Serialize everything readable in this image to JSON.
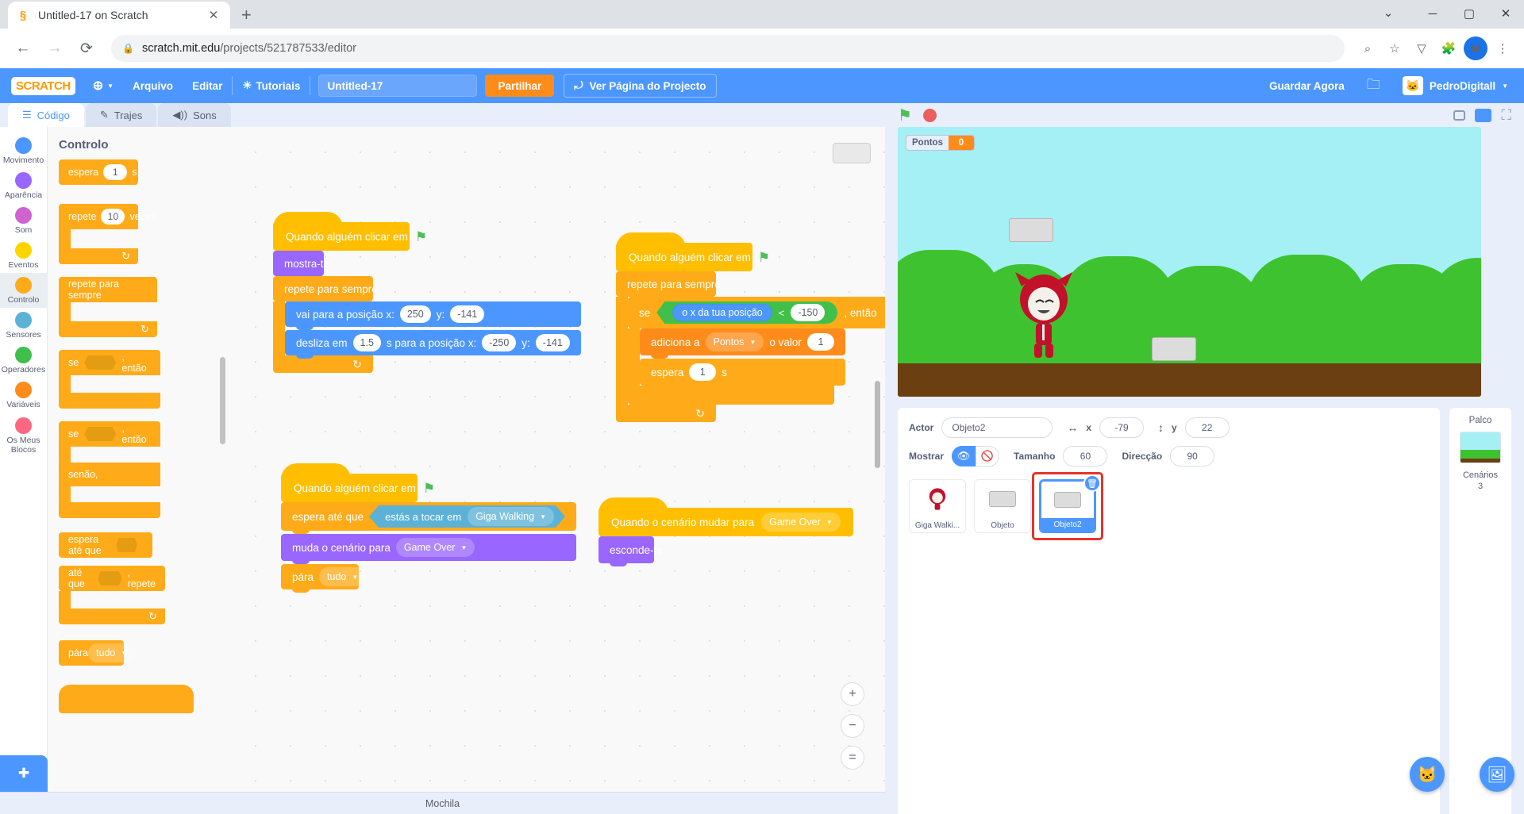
{
  "browser": {
    "tab_title": "Untitled-17 on Scratch",
    "tab_favicon": "scratch-icon",
    "new_tab": "+",
    "close": "✕",
    "url_host": "scratch.mit.edu",
    "url_path": "/projects/521787533/editor",
    "avatar_letter": "M",
    "minimize": "─",
    "maximize": "▢",
    "window_close": "✕"
  },
  "menu": {
    "logo": "SCRATCH",
    "language": "Arquivo",
    "file": "Arquivo",
    "edit": "Editar",
    "tutorials": "Tutoriais",
    "project_name": "Untitled-17",
    "share": "Partilhar",
    "see_project_page": "Ver Página do Projecto",
    "save_now": "Guardar Agora",
    "username": "PedroDigitall"
  },
  "tabs": [
    {
      "label": "Código",
      "icon": "code-icon"
    },
    {
      "label": "Trajes",
      "icon": "brush-icon"
    },
    {
      "label": "Sons",
      "icon": "speaker-icon"
    }
  ],
  "categories": [
    {
      "label": "Movimento",
      "color": "#4c97ff"
    },
    {
      "label": "Aparência",
      "color": "#9966ff"
    },
    {
      "label": "Som",
      "color": "#cf63cf"
    },
    {
      "label": "Eventos",
      "color": "#ffd500"
    },
    {
      "label": "Controlo",
      "color": "#ffab19"
    },
    {
      "label": "Sensores",
      "color": "#5cb1d6"
    },
    {
      "label": "Operadores",
      "color": "#40bf4a"
    },
    {
      "label": "Variáveis",
      "color": "#ff8c1a"
    },
    {
      "label": "Os Meus Blocos",
      "color": "#ff6680"
    }
  ],
  "palette": {
    "header": "Controlo",
    "wait_label": "espera",
    "wait_value": "1",
    "wait_unit": "s",
    "repeat_label": "repete",
    "repeat_value": "10",
    "repeat_unit": "vezes",
    "forever": "repete para sempre",
    "if_label": "se",
    "if_then": ", então",
    "else_label": "senão,",
    "wait_until": "espera até que",
    "until_label": "até que",
    "until_repeat": ", repete",
    "stop_label": "pára",
    "stop_value": "tudo",
    "loop_arrow": "↻"
  },
  "scripts": {
    "s1": {
      "hat": "Quando alguém clicar em",
      "show": "mostra-te",
      "forever": "repete para sempre",
      "goto_pre": "vai para a posição x:",
      "goto_x": "250",
      "goto_y_label": "y:",
      "goto_y": "-141",
      "glide_pre": "desliza em",
      "glide_secs": "1.5",
      "glide_mid": "s para a posição x:",
      "glide_x": "-250",
      "glide_y_label": "y:",
      "glide_y": "-141",
      "loop_arrow": "↻"
    },
    "s2": {
      "hat": "Quando alguém clicar em",
      "forever": "repete para sempre",
      "if_label": "se",
      "cond_reporter": "o x da tua posição",
      "cond_op": "<",
      "cond_value": "-150",
      "if_then": ", então",
      "change_pre": "adiciona a",
      "change_var": "Pontos",
      "change_mid": "o valor",
      "change_value": "1",
      "wait_label": "espera",
      "wait_value": "1",
      "wait_unit": "s",
      "loop_arrow": "↻"
    },
    "s3": {
      "hat": "Quando alguém clicar em",
      "wait_until": "espera até que",
      "touching": "estás a tocar em",
      "touching_target": "Giga Walking",
      "switch_pre": "muda o cenário para",
      "switch_target": "Game Over",
      "stop_label": "pára",
      "stop_value": "tudo"
    },
    "s4": {
      "hat_pre": "Quando o cenário mudar para",
      "hat_target": "Game Over",
      "hide": "esconde-te"
    }
  },
  "workspace": {
    "zoom_in": "+",
    "zoom_out": "−",
    "zoom_reset": "=",
    "backpack": "Mochila",
    "add_extension": "add-extension-icon"
  },
  "stage": {
    "score_label": "Pontos",
    "score_value": "0",
    "green_flag": "green-flag-icon",
    "stop": "stop-icon"
  },
  "sprite_info": {
    "actor_label": "Actor",
    "actor_name": "Objeto2",
    "x_label": "x",
    "x_value": "-79",
    "y_label": "y",
    "y_value": "22",
    "show_label": "Mostrar",
    "size_label": "Tamanho",
    "size_value": "60",
    "direction_label": "Direcção",
    "direction_value": "90"
  },
  "sprites": [
    {
      "name": "Giga Walki...",
      "type": "character",
      "selected": false
    },
    {
      "name": "Objeto",
      "type": "box",
      "selected": false
    },
    {
      "name": "Objeto2",
      "type": "box",
      "selected": true,
      "delete_icon": "trash-icon"
    }
  ],
  "stage_panel": {
    "title": "Palco",
    "backdrops_label": "Cenários",
    "backdrops_count": "3"
  }
}
